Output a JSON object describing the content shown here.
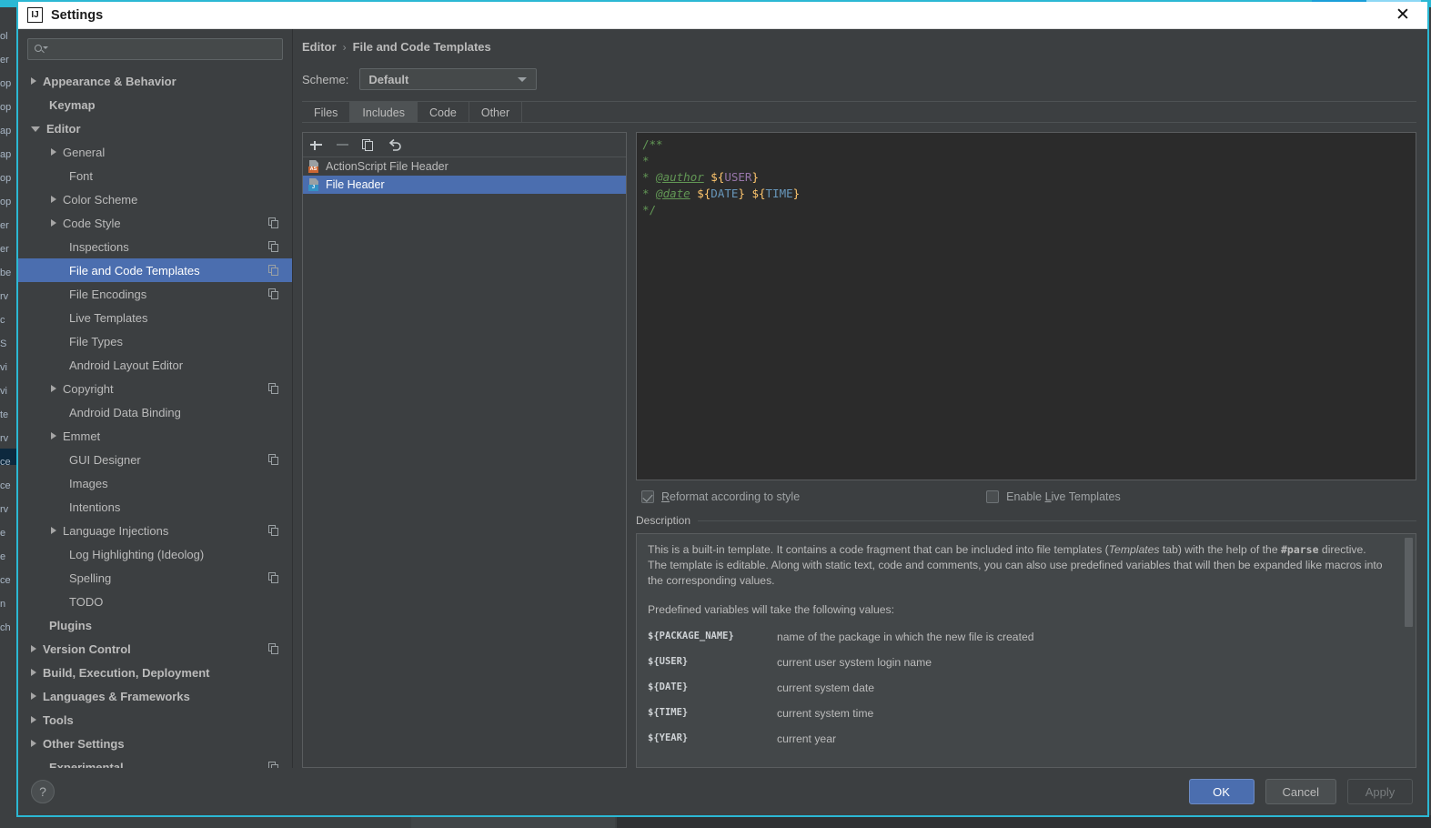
{
  "window": {
    "title": "Settings",
    "app_icon": "intellij-idea-icon",
    "close_label": "✕",
    "accent_color": "#2bb8d4"
  },
  "search": {
    "placeholder": "",
    "value": "",
    "icon": "search-icon"
  },
  "sidebar": {
    "items": [
      {
        "label": "Appearance & Behavior",
        "indent": 0,
        "arrow": "closed",
        "bold": true,
        "copy": false,
        "selected": false
      },
      {
        "label": "Keymap",
        "indent": 0,
        "arrow": "none",
        "bold": true,
        "copy": false,
        "selected": false
      },
      {
        "label": "Editor",
        "indent": 0,
        "arrow": "open",
        "bold": true,
        "copy": false,
        "selected": false
      },
      {
        "label": "General",
        "indent": 1,
        "arrow": "closed",
        "bold": false,
        "copy": false,
        "selected": false
      },
      {
        "label": "Font",
        "indent": 1,
        "arrow": "none",
        "bold": false,
        "copy": false,
        "selected": false
      },
      {
        "label": "Color Scheme",
        "indent": 1,
        "arrow": "closed",
        "bold": false,
        "copy": false,
        "selected": false
      },
      {
        "label": "Code Style",
        "indent": 1,
        "arrow": "closed",
        "bold": false,
        "copy": true,
        "selected": false
      },
      {
        "label": "Inspections",
        "indent": 1,
        "arrow": "none",
        "bold": false,
        "copy": true,
        "selected": false
      },
      {
        "label": "File and Code Templates",
        "indent": 1,
        "arrow": "none",
        "bold": false,
        "copy": true,
        "selected": true
      },
      {
        "label": "File Encodings",
        "indent": 1,
        "arrow": "none",
        "bold": false,
        "copy": true,
        "selected": false
      },
      {
        "label": "Live Templates",
        "indent": 1,
        "arrow": "none",
        "bold": false,
        "copy": false,
        "selected": false
      },
      {
        "label": "File Types",
        "indent": 1,
        "arrow": "none",
        "bold": false,
        "copy": false,
        "selected": false
      },
      {
        "label": "Android Layout Editor",
        "indent": 1,
        "arrow": "none",
        "bold": false,
        "copy": false,
        "selected": false
      },
      {
        "label": "Copyright",
        "indent": 1,
        "arrow": "closed",
        "bold": false,
        "copy": true,
        "selected": false
      },
      {
        "label": "Android Data Binding",
        "indent": 1,
        "arrow": "none",
        "bold": false,
        "copy": false,
        "selected": false
      },
      {
        "label": "Emmet",
        "indent": 1,
        "arrow": "closed",
        "bold": false,
        "copy": false,
        "selected": false
      },
      {
        "label": "GUI Designer",
        "indent": 1,
        "arrow": "none",
        "bold": false,
        "copy": true,
        "selected": false
      },
      {
        "label": "Images",
        "indent": 1,
        "arrow": "none",
        "bold": false,
        "copy": false,
        "selected": false
      },
      {
        "label": "Intentions",
        "indent": 1,
        "arrow": "none",
        "bold": false,
        "copy": false,
        "selected": false
      },
      {
        "label": "Language Injections",
        "indent": 1,
        "arrow": "closed",
        "bold": false,
        "copy": true,
        "selected": false
      },
      {
        "label": "Log Highlighting (Ideolog)",
        "indent": 1,
        "arrow": "none",
        "bold": false,
        "copy": false,
        "selected": false
      },
      {
        "label": "Spelling",
        "indent": 1,
        "arrow": "none",
        "bold": false,
        "copy": true,
        "selected": false
      },
      {
        "label": "TODO",
        "indent": 1,
        "arrow": "none",
        "bold": false,
        "copy": false,
        "selected": false
      },
      {
        "label": "Plugins",
        "indent": 0,
        "arrow": "none",
        "bold": true,
        "copy": false,
        "selected": false
      },
      {
        "label": "Version Control",
        "indent": 0,
        "arrow": "closed",
        "bold": true,
        "copy": true,
        "selected": false
      },
      {
        "label": "Build, Execution, Deployment",
        "indent": 0,
        "arrow": "closed",
        "bold": true,
        "copy": false,
        "selected": false
      },
      {
        "label": "Languages & Frameworks",
        "indent": 0,
        "arrow": "closed",
        "bold": true,
        "copy": false,
        "selected": false
      },
      {
        "label": "Tools",
        "indent": 0,
        "arrow": "closed",
        "bold": true,
        "copy": false,
        "selected": false
      },
      {
        "label": "Other Settings",
        "indent": 0,
        "arrow": "closed",
        "bold": true,
        "copy": false,
        "selected": false
      },
      {
        "label": "Experimental",
        "indent": 0,
        "arrow": "none",
        "bold": true,
        "copy": true,
        "selected": false
      }
    ]
  },
  "breadcrumb": {
    "parent": "Editor",
    "separator": "›",
    "current": "File and Code Templates"
  },
  "scheme": {
    "label": "Scheme:",
    "value": "Default",
    "chevron_icon": "chevron-down-icon"
  },
  "tabs": [
    {
      "label": "Files",
      "active": false
    },
    {
      "label": "Includes",
      "active": true
    },
    {
      "label": "Code",
      "active": false
    },
    {
      "label": "Other",
      "active": false
    }
  ],
  "list_toolbar": [
    {
      "name": "add-template-button",
      "icon": "plus-icon",
      "enabled": true
    },
    {
      "name": "remove-template-button",
      "icon": "minus-icon",
      "enabled": false
    },
    {
      "name": "copy-template-button",
      "icon": "copy-icon",
      "enabled": true
    },
    {
      "name": "reset-template-button",
      "icon": "undo-icon",
      "enabled": true
    }
  ],
  "template_list": [
    {
      "label": "ActionScript File Header",
      "badge": "AS",
      "badge_color": "#cc6633",
      "selected": false
    },
    {
      "label": "File Header",
      "badge": "J",
      "badge_color": "#3592c4",
      "selected": true
    }
  ],
  "editor": {
    "lines": [
      {
        "parts": [
          {
            "t": "/**",
            "c": "comment"
          }
        ]
      },
      {
        "parts": [
          {
            "t": "*",
            "c": "comment"
          }
        ]
      },
      {
        "parts": [
          {
            "t": "* ",
            "c": "comment"
          },
          {
            "t": "@author",
            "c": "tag"
          },
          {
            "t": " ",
            "c": "comment"
          },
          {
            "t": "${",
            "c": "brace"
          },
          {
            "t": "USER",
            "c": "name"
          },
          {
            "t": "}",
            "c": "brace"
          }
        ]
      },
      {
        "parts": [
          {
            "t": "* ",
            "c": "comment"
          },
          {
            "t": "@date",
            "c": "tag"
          },
          {
            "t": " ",
            "c": "comment"
          },
          {
            "t": "${",
            "c": "brace"
          },
          {
            "t": "DATE",
            "c": "name2"
          },
          {
            "t": "}",
            "c": "brace"
          },
          {
            "t": " ",
            "c": "comment"
          },
          {
            "t": "${",
            "c": "brace"
          },
          {
            "t": "TIME",
            "c": "name2"
          },
          {
            "t": "}",
            "c": "brace"
          }
        ]
      },
      {
        "parts": [
          {
            "t": "*/",
            "c": "comment"
          }
        ]
      }
    ]
  },
  "checkboxes": [
    {
      "label_pre": "",
      "label_mnemonic": "R",
      "label_post": "eformat according to style",
      "checked": true,
      "name": "reformat-according-to-style-checkbox"
    },
    {
      "label_pre": "Enable ",
      "label_mnemonic": "L",
      "label_post": "ive Templates",
      "checked": false,
      "name": "enable-live-templates-checkbox"
    }
  ],
  "description": {
    "title": "Description",
    "para1_a": "This is a built-in template. It contains a code fragment that can be included into file templates (",
    "para1_em": "Templates",
    "para1_b": " tab) with the help of the ",
    "para1_mono": "#parse",
    "para1_c": " directive.",
    "para2": "The template is editable. Along with static text, code and comments, you can also use predefined variables that will then be expanded like macros into the corresponding values.",
    "para3": "Predefined variables will take the following values:",
    "variables": [
      {
        "name": "${PACKAGE_NAME}",
        "desc": "name of the package in which the new file is created"
      },
      {
        "name": "${USER}",
        "desc": "current user system login name"
      },
      {
        "name": "${DATE}",
        "desc": "current system date"
      },
      {
        "name": "${TIME}",
        "desc": "current system time"
      },
      {
        "name": "${YEAR}",
        "desc": "current year"
      }
    ]
  },
  "footer": {
    "help_label": "?",
    "ok_label": "OK",
    "cancel_label": "Cancel",
    "apply_label": "Apply"
  },
  "background": {
    "left_fragments": [
      "ol",
      "er",
      "op",
      "op",
      "ap",
      "ap",
      "op",
      "op",
      "er",
      "er",
      "be",
      "rv",
      "c",
      "S",
      "vi",
      "vi",
      "te",
      "rv",
      "ce",
      "ce",
      "rv",
      "e",
      "e",
      "ce",
      "n",
      "ch"
    ]
  }
}
